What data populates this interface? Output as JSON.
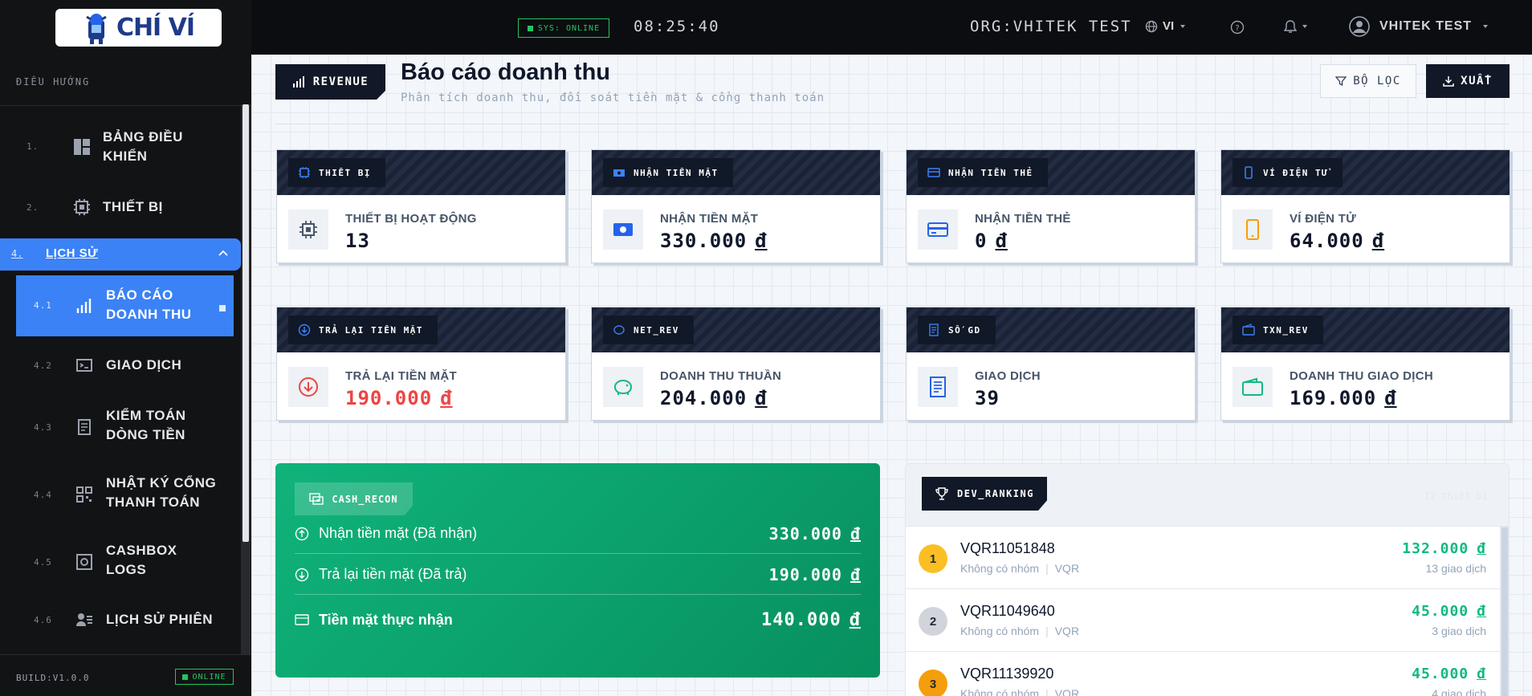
{
  "brand": {
    "name": "CHÍ VÍ"
  },
  "sidebar": {
    "header": "ĐIỀU HƯỚNG",
    "items": [
      {
        "num": "1.",
        "label_l1": "BẢNG ĐIỀU",
        "label_l2": "KHIỂN",
        "icon": "dashboard-icon"
      },
      {
        "num": "2.",
        "label": "THIẾT BỊ",
        "icon": "chip-icon"
      }
    ],
    "group": {
      "num": "4.",
      "label": "LỊCH SỬ",
      "expanded": true
    },
    "subitems": [
      {
        "num": "4.1",
        "label_l1": "BÁO CÁO",
        "label_l2": "DOANH THU",
        "icon": "bar-chart-icon",
        "active": true
      },
      {
        "num": "4.2",
        "label": "GIAO DỊCH",
        "icon": "terminal-icon"
      },
      {
        "num": "4.3",
        "label_l1": "KIỂM TOÁN",
        "label_l2": "DÒNG TIỀN",
        "icon": "ledger-icon"
      },
      {
        "num": "4.4",
        "label_l1": "NHẬT KÝ CỔNG",
        "label_l2": "THANH TOÁN",
        "icon": "qr-icon"
      },
      {
        "num": "4.5",
        "label_l1": "CASHBOX",
        "label_l2": "LOGS",
        "icon": "safe-icon"
      },
      {
        "num": "4.6",
        "label": "LỊCH SỬ PHIÊN",
        "icon": "user-list-icon"
      }
    ],
    "build": "BUILD:V1.0.0",
    "status": "ONLINE"
  },
  "topbar": {
    "sys_status": "SYS: ONLINE",
    "clock": "08:25:40",
    "org": "ORG:VHITEK TEST",
    "lang": "VI",
    "user": "VHITEK TEST"
  },
  "page": {
    "tag": "REVENUE",
    "title": "Báo cáo doanh thu",
    "subtitle": "Phân tích doanh thu, đối soát tiền mặt & cổng thanh toán",
    "filter_label": "BỘ LỌC",
    "export_label": "XUẤT"
  },
  "cards": [
    {
      "tab": "THIẾT BỊ",
      "label": "THIẾT BỊ HOẠT ĐỘNG",
      "value": "13",
      "unit": "",
      "icon": "chip-icon"
    },
    {
      "tab": "NHẬN TIỀN MẶT",
      "label": "NHẬN TIỀN MẶT",
      "value": "330.000",
      "unit": "đ",
      "icon": "cash-icon"
    },
    {
      "tab": "NHẬN TIỀN THẺ",
      "label": "NHẬN TIỀN THẺ",
      "value": "0",
      "unit": "đ",
      "icon": "card-icon"
    },
    {
      "tab": "VÍ ĐIỆN TỬ",
      "label": "VÍ ĐIỆN TỬ",
      "value": "64.000",
      "unit": "đ",
      "icon": "phone-icon"
    },
    {
      "tab": "TRẢ LẠI TIỀN MẶT",
      "label": "TRẢ LẠI TIỀN MẶT",
      "value": "190.000",
      "unit": "đ",
      "icon": "arrow-down-circle-icon"
    },
    {
      "tab": "NET_REV",
      "label": "DOANH THU THUẦN",
      "value": "204.000",
      "unit": "đ",
      "icon": "piggy-bank-icon"
    },
    {
      "tab": "SỐ GD",
      "label": "GIAO DỊCH",
      "value": "39",
      "unit": "",
      "icon": "receipt-icon"
    },
    {
      "tab": "TXN_REV",
      "label": "DOANH THU GIAO DỊCH",
      "value": "169.000",
      "unit": "đ",
      "icon": "wallet-icon"
    }
  ],
  "cash_recon": {
    "tag": "CASH_RECON",
    "rows": [
      {
        "label": "Nhận tiền mặt (Đã nhận)",
        "value": "330.000",
        "unit": "đ"
      },
      {
        "label": "Trả lại tiền mặt (Đã trả)",
        "value": "190.000",
        "unit": "đ"
      },
      {
        "label": "Tiền mặt thực nhận",
        "value": "140.000",
        "unit": "đ"
      }
    ]
  },
  "ranking": {
    "tag": "DEV_RANKING",
    "count": "12 thiết bị",
    "rows": [
      {
        "rank": "1",
        "name": "VQR11051848",
        "group": "Không có nhóm",
        "type": "VQR",
        "amount": "132.000",
        "unit": "đ",
        "txn": "13 giao dịch",
        "color": "#fbbf24"
      },
      {
        "rank": "2",
        "name": "VQR11049640",
        "group": "Không có nhóm",
        "type": "VQR",
        "amount": "45.000",
        "unit": "đ",
        "txn": "3 giao dịch",
        "color": "#d1d5db"
      },
      {
        "rank": "3",
        "name": "VQR11139920",
        "group": "Không có nhóm",
        "type": "VQR",
        "amount": "45.000",
        "unit": "đ",
        "txn": "4 giao dịch",
        "color": "#f59e0b"
      }
    ]
  },
  "colors": {
    "accent": "#3b82f6",
    "dark": "#111827",
    "green": "#10b981",
    "red": "#ef4444",
    "online": "#22c55e"
  }
}
